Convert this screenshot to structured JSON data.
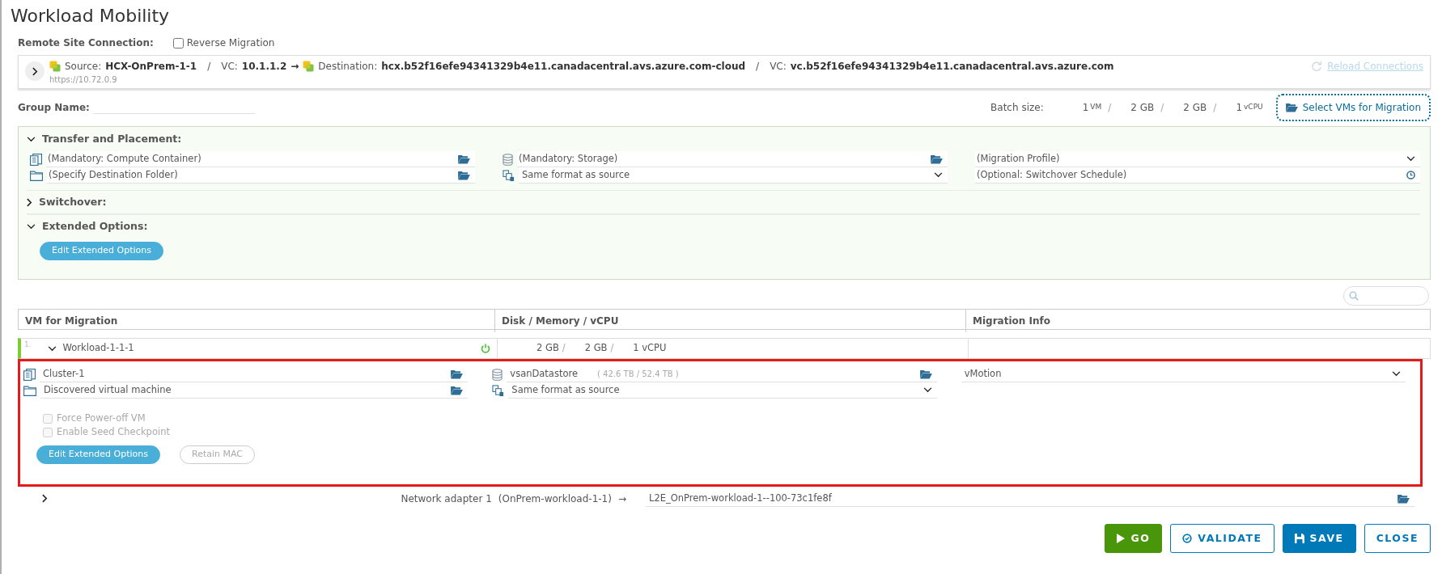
{
  "title": "Workload Mobility",
  "remote_site": {
    "label": "Remote Site Connection:",
    "reverse_migration": {
      "label": "Reverse Migration",
      "checked": false
    }
  },
  "connection": {
    "expanded": false,
    "source_label": "Source:",
    "source": "HCX-OnPrem-1-1",
    "separator_1": "/",
    "source_vc_label": "VC:",
    "source_vc": "10.1.1.2",
    "arrow": "→",
    "destination_label": "Destination:",
    "destination": "hcx.b52f16efe94341329b4e11.canadacentral.avs.azure.com-cloud",
    "separator_2": "/",
    "destination_vc_label": "VC:",
    "destination_vc": "vc.b52f16efe94341329b4e11.canadacentral.avs.azure.com",
    "url": "https://10.72.0.9",
    "reload": {
      "label": "Reload Connections",
      "disabled": true
    }
  },
  "group_name": {
    "label": "Group Name:"
  },
  "batch": {
    "label": "Batch size:",
    "items": [
      {
        "value": "1",
        "unit": "VM",
        "separator": "/"
      },
      {
        "value": "2 GB",
        "separator": "/"
      },
      {
        "value": "2 GB",
        "separator": "/"
      },
      {
        "value": "1",
        "unit": "vCPU"
      }
    ]
  },
  "select_vms_button": {
    "label": "Select VMs for Migration"
  },
  "sections": [
    {
      "kind": "fields",
      "title": "Transfer and Placement:",
      "expanded": true,
      "fields": {
        "compute_container": {
          "placeholder": "(Mandatory: Compute Container)"
        },
        "storage": {
          "placeholder": "(Mandatory: Storage)"
        },
        "migration_profile": {
          "placeholder": "(Migration Profile)"
        },
        "destination_folder": {
          "placeholder": "(Specify Destination Folder)"
        },
        "disk_format": {
          "value": "Same format as source"
        },
        "switchover_schedule": {
          "placeholder": "(Optional: Switchover Schedule)"
        }
      }
    },
    {
      "kind": "plain",
      "title": "Switchover:",
      "expanded": false
    },
    {
      "kind": "button",
      "title": "Extended Options:",
      "expanded": true,
      "button": "Edit Extended Options"
    }
  ],
  "table": {
    "columns": [
      "VM for Migration",
      "Disk / Memory / vCPU",
      "Migration Info"
    ],
    "rows": [
      {
        "index": "1.",
        "expanded": true,
        "name": "Workload-1-1-1",
        "powered_on": true,
        "resources": [
          {
            "value": "2 GB",
            "separator": "/"
          },
          {
            "value": "2 GB",
            "separator": "/"
          },
          {
            "value": "1 vCPU"
          }
        ],
        "details": {
          "fields": {
            "compute_container": {
              "value": "Cluster-1"
            },
            "storage": {
              "value": "vsanDatastore",
              "capacity": "( 42.6 TB / 52.4 TB )"
            },
            "migration_profile": {
              "value": "vMotion"
            },
            "destination_folder": {
              "value": "Discovered virtual machine"
            },
            "disk_format": {
              "value": "Same format as source"
            }
          },
          "options": [
            {
              "label": "Force Power-off VM",
              "checked": false,
              "disabled": true
            },
            {
              "label": "Enable Seed Checkpoint",
              "checked": false,
              "disabled": true
            }
          ],
          "buttons": [
            {
              "label": "Edit Extended Options",
              "disabled": false
            },
            {
              "label": "Retain MAC",
              "disabled": true
            }
          ]
        },
        "network_adapters": [
          {
            "expanded": false,
            "label": "Network adapter 1",
            "source": "(OnPrem-workload-1-1)",
            "arrow": "→",
            "target": "L2E_OnPrem-workload-1--100-73c1fe8f"
          }
        ]
      }
    ]
  },
  "actions": [
    {
      "kind": "go",
      "label": "GO"
    },
    {
      "kind": "validate",
      "label": "VALIDATE"
    },
    {
      "kind": "save",
      "label": "SAVE"
    },
    {
      "kind": "close",
      "label": "CLOSE"
    }
  ]
}
